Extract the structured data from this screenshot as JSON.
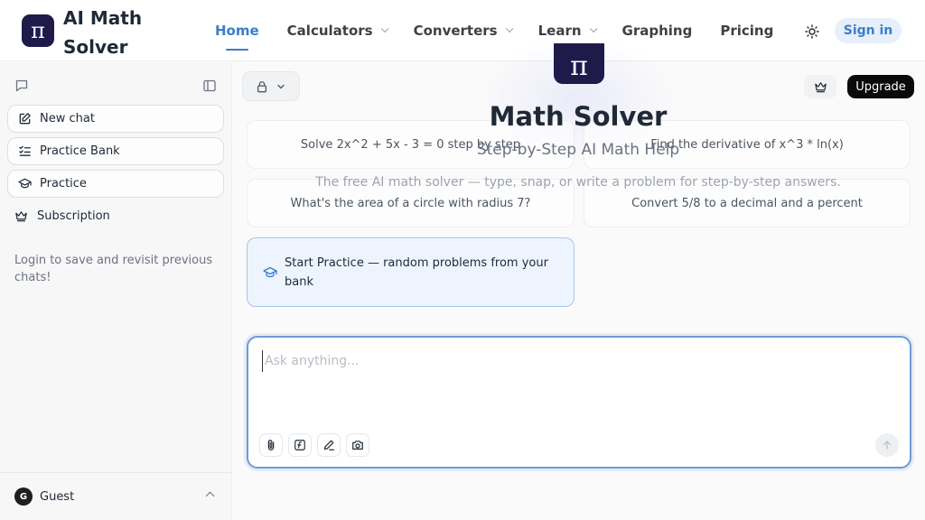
{
  "brand": {
    "logo_glyph": "π",
    "name": "AI Math Solver"
  },
  "nav": {
    "items": [
      {
        "label": "Home",
        "active": true,
        "dropdown": false
      },
      {
        "label": "Calculators",
        "active": false,
        "dropdown": true
      },
      {
        "label": "Converters",
        "active": false,
        "dropdown": true
      },
      {
        "label": "Learn",
        "active": false,
        "dropdown": true
      },
      {
        "label": "Graphing",
        "active": false,
        "dropdown": false
      },
      {
        "label": "Pricing",
        "active": false,
        "dropdown": false
      }
    ],
    "theme_icon": "sun-icon",
    "signin_label": "Sign in"
  },
  "sidebar": {
    "new_chat": "New chat",
    "practice_bank": "Practice Bank",
    "practice": "Practice",
    "subscription": "Subscription",
    "note": "Login to save and revisit previous chats!",
    "user": {
      "initial": "G",
      "name": "Guest"
    }
  },
  "toolbar": {
    "upgrade_label": "Upgrade"
  },
  "hero": {
    "logo_glyph": "π",
    "title": "Math Solver",
    "subtitle": "Step-by-Step AI Math Help",
    "description": "The free AI math solver — type, snap, or write a problem for step-by-step answers."
  },
  "suggestions": [
    "Solve 2x^2 + 5x - 3 = 0 step by step",
    "Find the derivative of x^3 * ln(x)",
    "What's the area of a circle with radius 7?",
    "Convert 5/8 to a decimal and a percent"
  ],
  "practice_card": {
    "label": "Start Practice — random problems from your bank"
  },
  "composer": {
    "placeholder": "Ask anything...",
    "value": "",
    "tools": [
      "paperclip-icon",
      "function-icon",
      "pen-icon",
      "camera-icon"
    ]
  },
  "colors": {
    "accent": "#3b7ec8",
    "brand_dark": "#1e1b4b",
    "upgrade_bg": "#0a0a0a"
  }
}
